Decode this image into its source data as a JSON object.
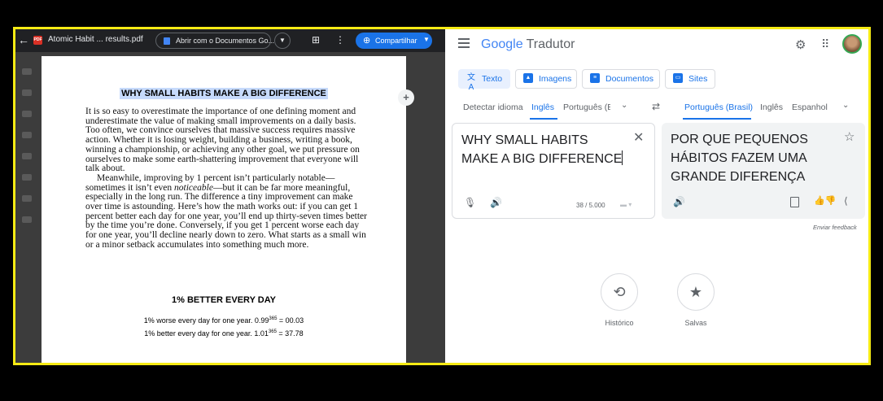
{
  "pdf": {
    "file_name": "Atomic Habit ... results.pdf",
    "open_with_label": "Abrir com o Documentos Go...",
    "share_label": "Compartilhar",
    "heading": "WHY SMALL HABITS MAKE A BIG DIFFERENCE",
    "paragraph1": "It is so easy to overestimate the importance of one defining moment and underestimate the value of making small improvements on a daily basis. Too often, we convince ourselves that massive success requires massive action. Whether it is losing weight, building a business, writing a book, winning a championship, or achieving any other goal, we put pressure on ourselves to make some earth-shattering improvement that everyone will talk about.",
    "paragraph2_a": "Meanwhile, improving by 1 percent isn’t particularly notable—sometimes it isn’t even ",
    "paragraph2_em": "noticeable",
    "paragraph2_b": "—but it can be far more meaningful, especially in the long run. The difference a tiny improvement can make over time is astounding. Here’s how the math works out: if you can get 1 percent better each day for one year, you’ll end up thirty-seven times better by the time you’re done. Conversely, if you get 1 percent worse each day for one year, you’ll decline nearly down to zero. What starts as a small win or a minor setback accumulates into something much more.",
    "subheading": "1% BETTER EVERY DAY",
    "formula1_a": "1% worse every day for one year. 0.99",
    "formula1_sup": "365",
    "formula1_b": " = 00.03",
    "formula2_a": "1% better every day for one year. 1.01",
    "formula2_sup": "365",
    "formula2_b": " = 37.78"
  },
  "translate": {
    "logo_google": "Google",
    "logo_product": "Tradutor",
    "tabs": [
      {
        "label": "Texto"
      },
      {
        "label": "Imagens"
      },
      {
        "label": "Documentos"
      },
      {
        "label": "Sites"
      }
    ],
    "source_langs": [
      "Detectar idioma",
      "Inglês",
      "Português (B"
    ],
    "target_langs": [
      "Português (Brasil)",
      "Inglês",
      "Espanhol"
    ],
    "source_text": "WHY SMALL HABITS MAKE A BIG DIFFERENCE",
    "char_count": "38 / 5.000",
    "target_text": "POR QUE PEQUENOS HÁBITOS FAZEM UMA GRANDE DIFERENÇA",
    "feedback": "Enviar feedback",
    "history_label": "Histórico",
    "saved_label": "Salvas"
  },
  "colors": {
    "accent": "#1a73e8",
    "highlight_border": "#f6eb14",
    "pdf_bg": "#3c3c3c"
  }
}
